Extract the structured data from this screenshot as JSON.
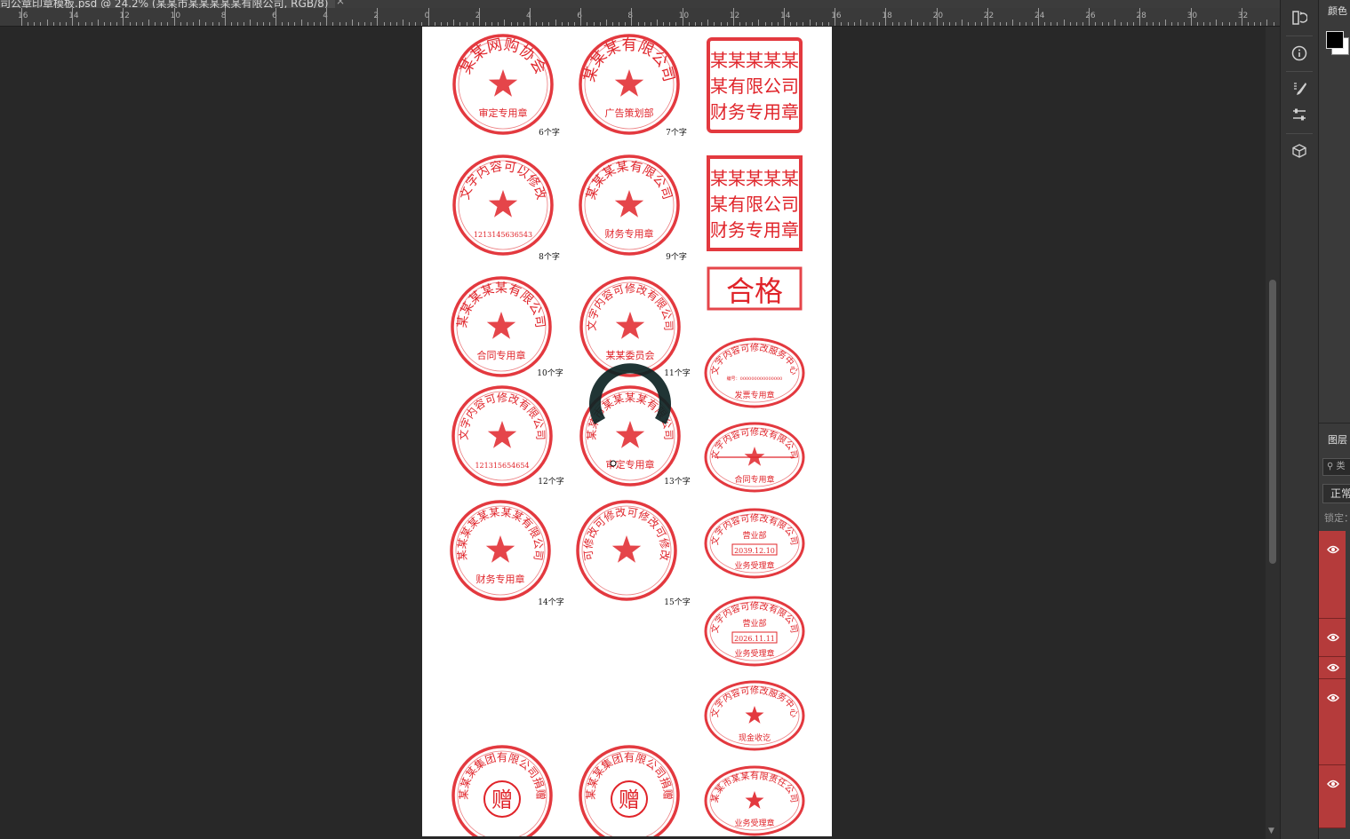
{
  "document_tab": {
    "title": "司公章印章模板.psd @ 24.2% (某某市某某某某某有限公司, RGB/8)",
    "close_glyph": "×"
  },
  "ruler": {
    "labels": [
      "16",
      "14",
      "12",
      "10",
      "8",
      "6",
      "4",
      "2",
      "0",
      "2",
      "4",
      "6",
      "8",
      "10",
      "12",
      "14",
      "16",
      "18",
      "20",
      "22",
      "24",
      "26",
      "28",
      "30",
      "32"
    ]
  },
  "stamps": {
    "round": [
      {
        "text": "某某网购协会",
        "bottom": "审定专用章",
        "count": "6个字"
      },
      {
        "text": "某某某有限公司",
        "bottom": "广告策划部",
        "count": "7个字"
      },
      {
        "text": "文字内容可以修改",
        "bottom": "1213145636543",
        "count": "8个字"
      },
      {
        "text": "某某某某有限公司",
        "bottom": "财务专用章",
        "count": "9个字"
      },
      {
        "text": "某某某某某有限公司",
        "bottom": "合同专用章",
        "count": "10个字"
      },
      {
        "text": "文字内容可修改有限公司",
        "bottom": "某某委员会",
        "count": "11个字"
      },
      {
        "text": "文字内容可修改有限公司",
        "bottom": "121315654654",
        "count": "12个字"
      },
      {
        "text": "某某市某某某某有限公司",
        "bottom": "审定专用章",
        "count": "13个字"
      },
      {
        "text": "某某某某某某某某有限公司",
        "bottom": "财务专用章",
        "count": "14个字"
      },
      {
        "text": "可修改可修改可修改可修改",
        "bottom": "",
        "count": "15个字"
      },
      {
        "text": "某某某集团有限公司捐赠",
        "center": "赠",
        "count": ""
      },
      {
        "text": "某某某集团有限公司捐赠",
        "center": "赠",
        "count": ""
      }
    ],
    "square": [
      {
        "lines": [
          "某某某某某",
          "某有限公司",
          "财务专用章"
        ]
      },
      {
        "lines": [
          "某某某某某",
          "某有限公司",
          "财务专用章"
        ]
      }
    ],
    "rect_label": "合格",
    "oval": [
      {
        "text": "文字内容可修改服务中心",
        "sub": "编号：000000000000000",
        "bottom": "发票专用章"
      },
      {
        "text": "文字内容可修改有限公司",
        "bottom": "合同专用章"
      },
      {
        "text": "文字内容可修改有限公司",
        "mid": "营业部",
        "date": "2039.12.10",
        "bottom": "业务受理章"
      },
      {
        "text": "文字内容可修改有限公司",
        "mid": "营业部",
        "date": "2026.11.11",
        "bottom": "业务受理章"
      },
      {
        "text": "文字内容可修改服务中心",
        "bottom": "现金收讫"
      },
      {
        "text": "某某市某某有限责任公司",
        "bottom": "业务受理章"
      }
    ]
  },
  "right_panel": {
    "color_title": "颜色",
    "layers_title": "图层",
    "search_placeholder": "类",
    "blend_mode": "正常",
    "lock_label": "锁定："
  },
  "tool_icons": [
    "history-icon",
    "info-icon",
    "brush-settings-icon",
    "adjustments-icon",
    "3d-icon"
  ],
  "colors": {
    "stamp_red": "#e0242a",
    "layer_selected": "#b53b3b"
  }
}
